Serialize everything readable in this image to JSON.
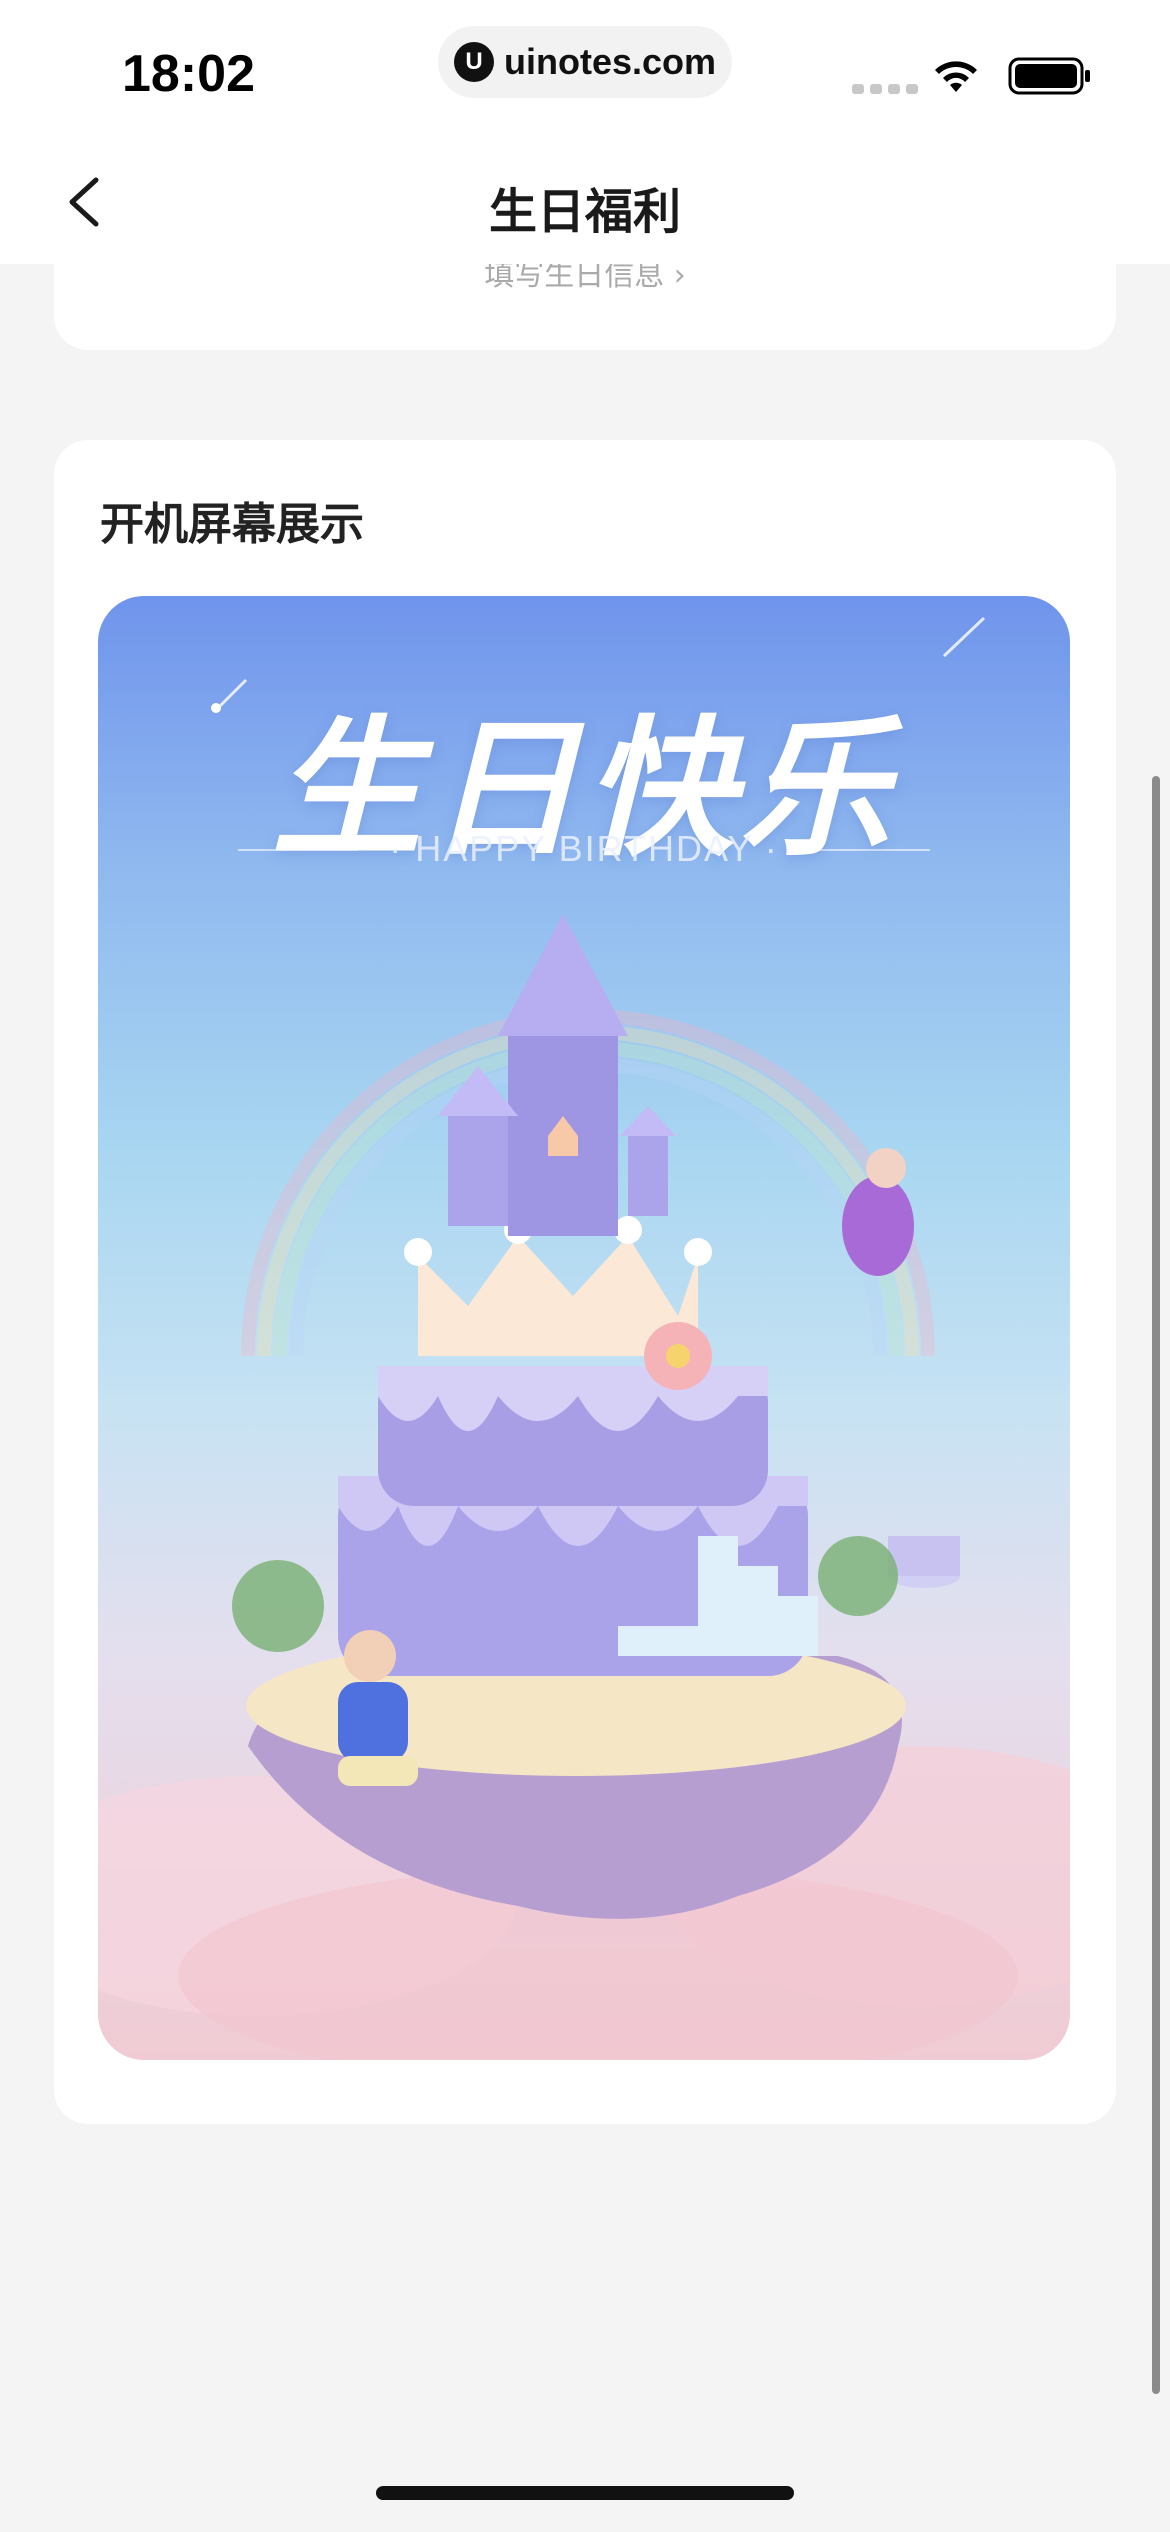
{
  "status_bar": {
    "time": "18:02",
    "url": "uinotes.com",
    "url_logo_glyph": "U"
  },
  "nav": {
    "title": "生日福利",
    "back_icon": "chevron-left-icon"
  },
  "profile_card": {
    "link_text": "填写生日信息 ›"
  },
  "splash_section": {
    "title": "开机屏幕展示",
    "poster_title": "生日快乐",
    "poster_subtitle": "· HAPPY BIRTHDAY ·"
  },
  "colors": {
    "background": "#f4f4f4",
    "card": "#ffffff",
    "poster_top": "#6f94ec",
    "poster_bottom": "#f0cbd3",
    "cake": "#b9b2ec"
  }
}
